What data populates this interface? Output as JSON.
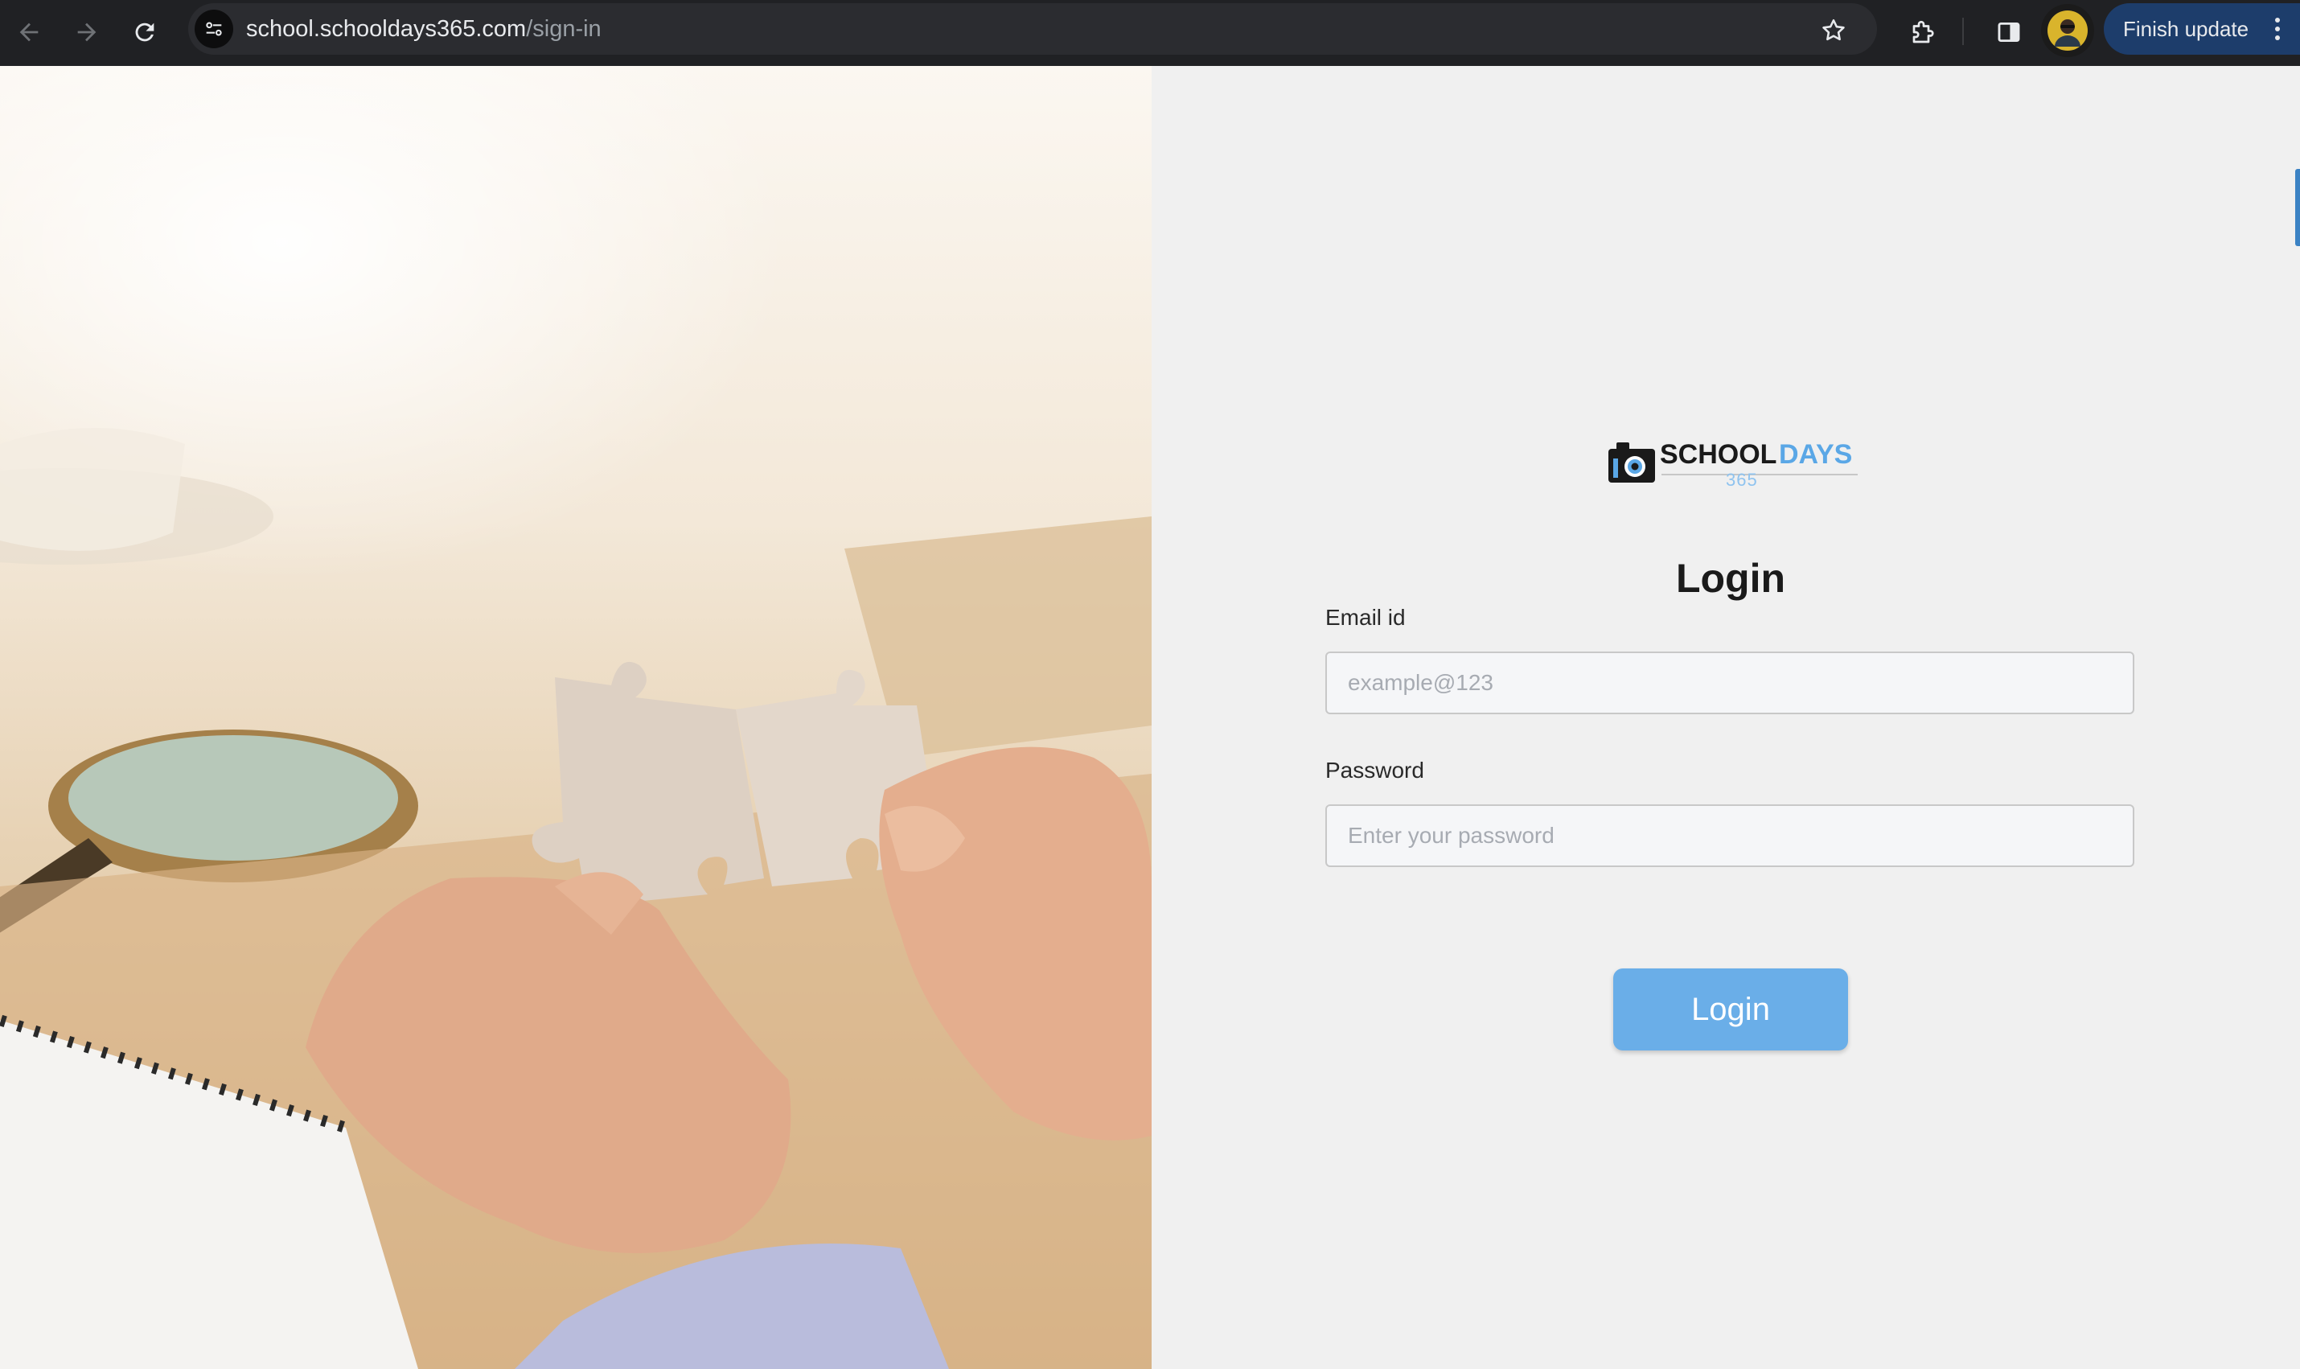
{
  "browser": {
    "url_host": "school.schooldays365.com",
    "url_path": "/sign-in",
    "finish_update_label": "Finish update"
  },
  "logo": {
    "word1": "SCHOOL",
    "word2": "DAYS",
    "number": "365",
    "word1_color": "#1a1a1a",
    "word2_color": "#5aa7e6"
  },
  "login_form": {
    "title": "Login",
    "email_label": "Email id",
    "email_placeholder": "example@123",
    "email_value": "",
    "password_label": "Password",
    "password_placeholder": "Enter your password",
    "password_value": "",
    "submit_label": "Login"
  },
  "colors": {
    "accent": "#6aaee8",
    "chrome_bg": "#202124",
    "update_btn": "#1d3d6b"
  }
}
